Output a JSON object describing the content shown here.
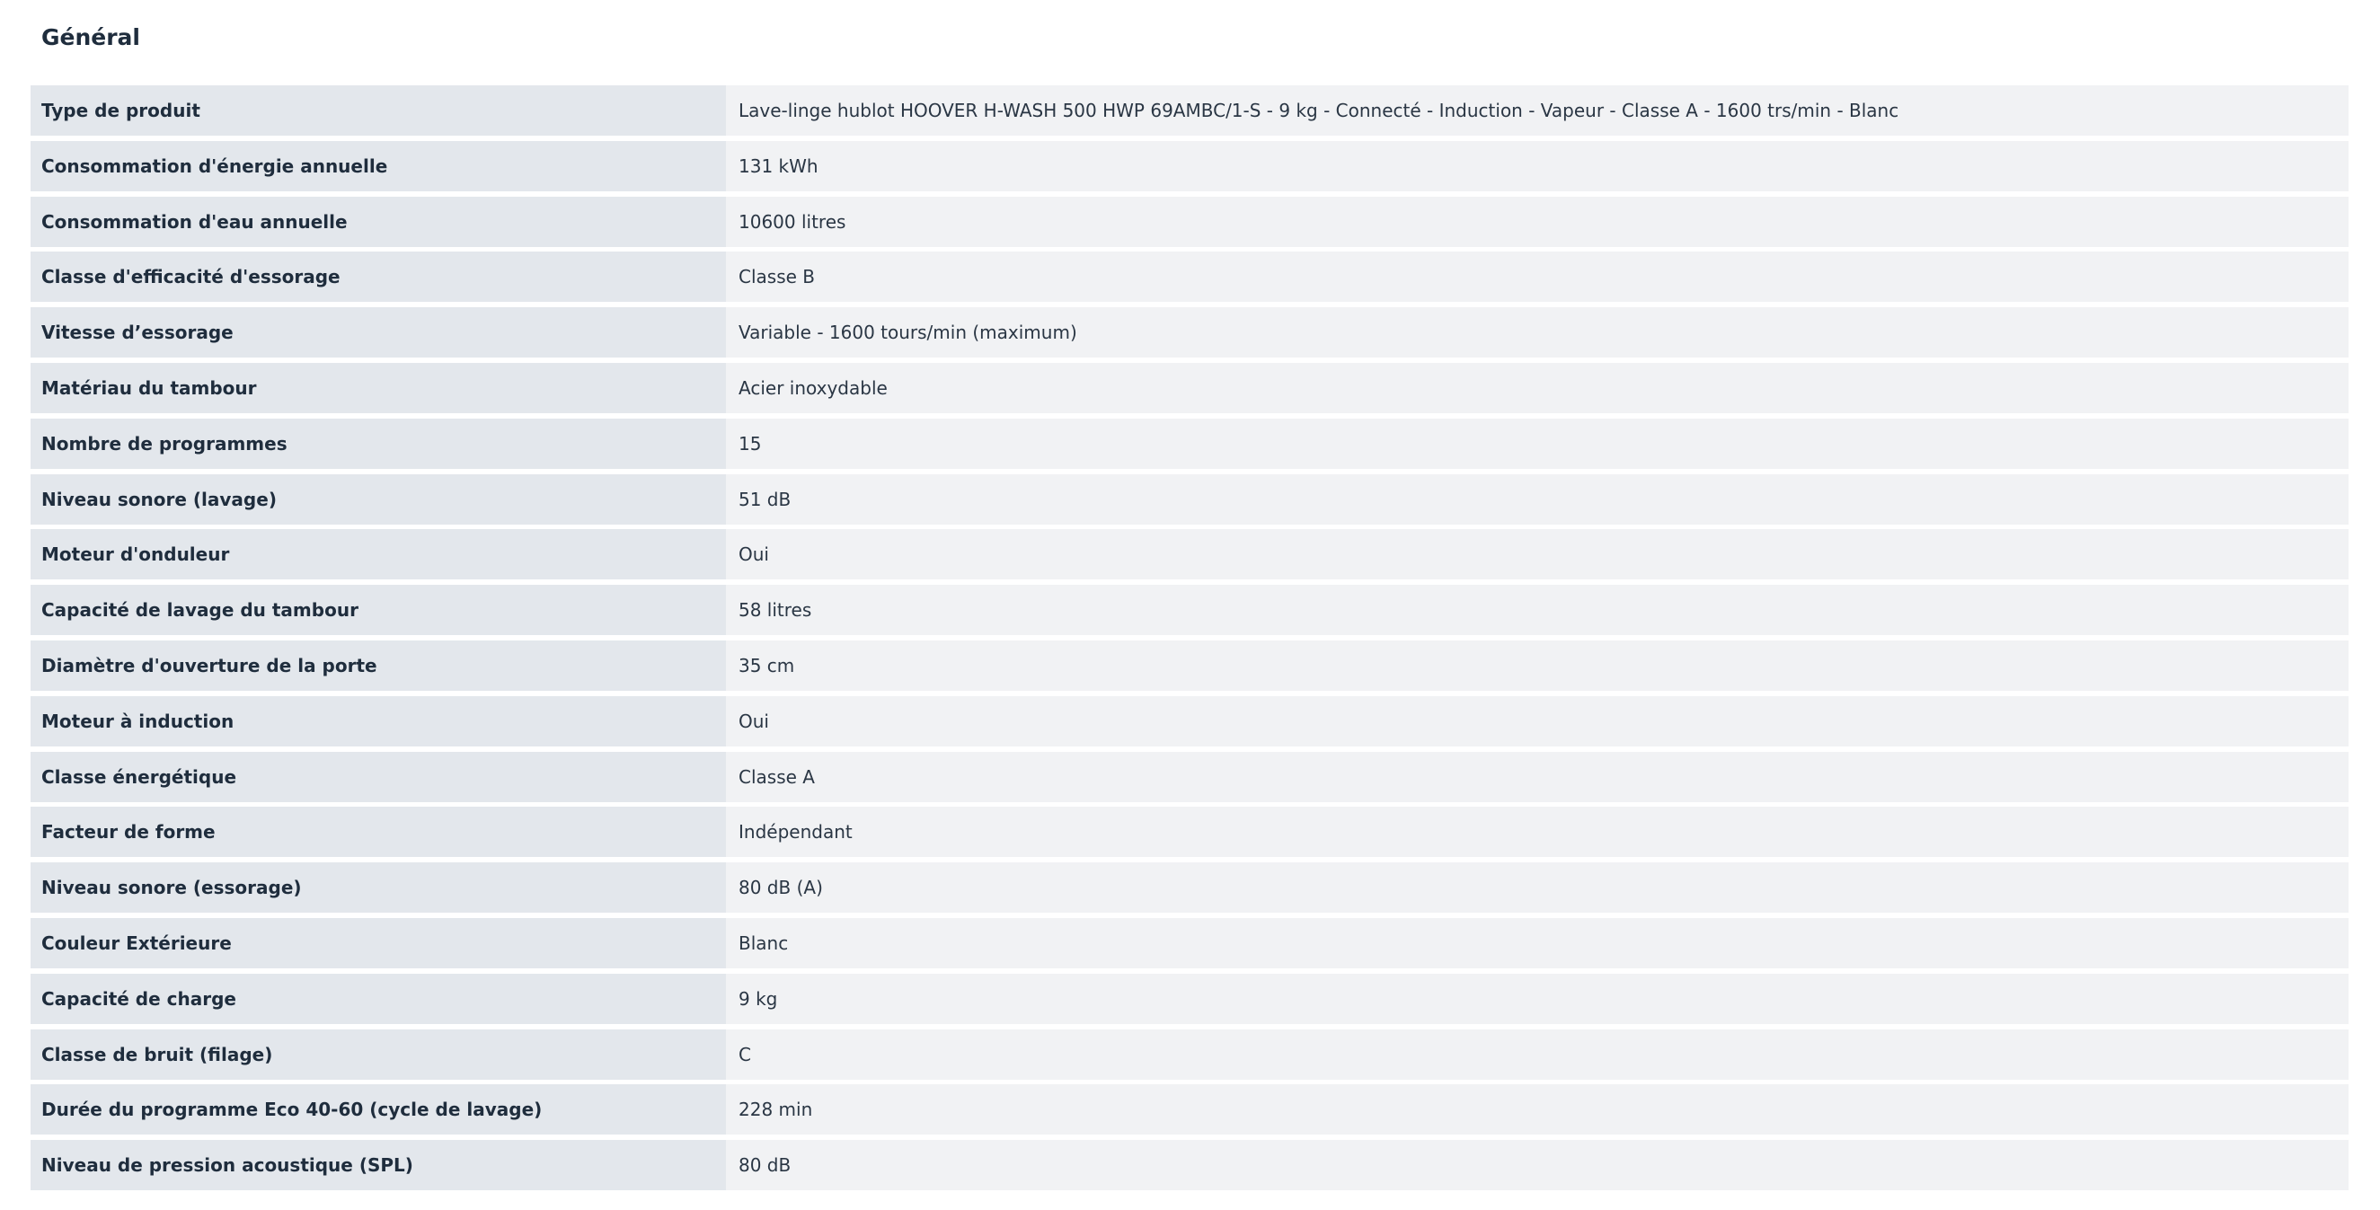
{
  "section": {
    "title": "Général"
  },
  "specs": [
    {
      "label": "Type de produit",
      "value": "Lave-linge hublot HOOVER H-WASH 500 HWP 69AMBC/1-S - 9 kg - Connecté - Induction - Vapeur - Classe A - 1600 trs/min - Blanc"
    },
    {
      "label": "Consommation d'énergie annuelle",
      "value": "131 kWh"
    },
    {
      "label": "Consommation d'eau annuelle",
      "value": "10600 litres"
    },
    {
      "label": "Classe d'efficacité d'essorage",
      "value": "Classe B"
    },
    {
      "label": "Vitesse d’essorage",
      "value": "Variable - 1600 tours/min (maximum)"
    },
    {
      "label": "Matériau du tambour",
      "value": "Acier inoxydable"
    },
    {
      "label": "Nombre de programmes",
      "value": "15"
    },
    {
      "label": "Niveau sonore (lavage)",
      "value": "51 dB"
    },
    {
      "label": "Moteur d'onduleur",
      "value": "Oui"
    },
    {
      "label": "Capacité de lavage du tambour",
      "value": "58 litres"
    },
    {
      "label": "Diamètre d'ouverture de la porte",
      "value": "35 cm"
    },
    {
      "label": "Moteur à induction",
      "value": "Oui"
    },
    {
      "label": "Classe énergétique",
      "value": "Classe A"
    },
    {
      "label": "Facteur de forme",
      "value": "Indépendant"
    },
    {
      "label": "Niveau sonore (essorage)",
      "value": "80 dB (A)"
    },
    {
      "label": "Couleur Extérieure",
      "value": "Blanc"
    },
    {
      "label": "Capacité de charge",
      "value": "9 kg"
    },
    {
      "label": "Classe de bruit (filage)",
      "value": "C"
    },
    {
      "label": "Durée du programme Eco 40-60 (cycle de lavage)",
      "value": "228 min"
    },
    {
      "label": "Niveau de pression acoustique (SPL)",
      "value": "80 dB"
    }
  ],
  "colors": {
    "label_bg": "#e3e7ec",
    "value_bg": "#f1f2f4",
    "text": "#1f2d3d"
  }
}
